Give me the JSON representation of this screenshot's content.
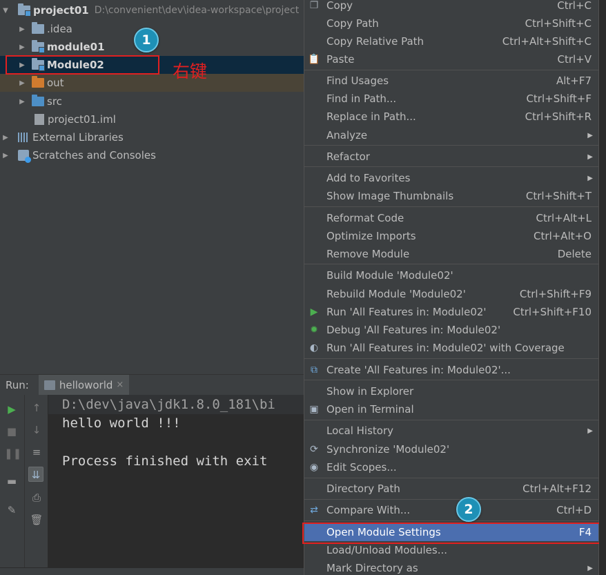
{
  "tree": {
    "project_name": "project01",
    "project_path": "D:\\convenient\\dev\\idea-workspace\\project",
    "items": [
      {
        "label": ".idea"
      },
      {
        "label": "module01"
      },
      {
        "label": "Module02"
      },
      {
        "label": "out"
      },
      {
        "label": "src"
      },
      {
        "label": "project01.iml"
      }
    ],
    "external_libraries": "External Libraries",
    "scratches": "Scratches and Consoles"
  },
  "annotations": {
    "badge1": "1",
    "badge2": "2",
    "right_click_note": "右键",
    "highlight_color": "#e02020"
  },
  "run": {
    "label": "Run:",
    "tab": "helloworld",
    "tab_close": "×",
    "console_lines": [
      "D:\\dev\\java\\jdk1.8.0_181\\bi",
      "hello world !!!",
      "",
      "Process finished with exit"
    ]
  },
  "menu": {
    "items": [
      {
        "label": "Copy",
        "shortcut": "Ctrl+C",
        "icon": "copy-icon"
      },
      {
        "label": "Copy Path",
        "shortcut": "Ctrl+Shift+C"
      },
      {
        "label": "Copy Relative Path",
        "shortcut": "Ctrl+Alt+Shift+C"
      },
      {
        "label": "Paste",
        "shortcut": "Ctrl+V",
        "icon": "paste-icon"
      },
      {
        "label": "Find Usages",
        "shortcut": "Alt+F7"
      },
      {
        "label": "Find in Path...",
        "shortcut": "Ctrl+Shift+F"
      },
      {
        "label": "Replace in Path...",
        "shortcut": "Ctrl+Shift+R"
      },
      {
        "label": "Analyze",
        "shortcut": ""
      },
      {
        "label": "Refactor",
        "shortcut": ""
      },
      {
        "label": "Add to Favorites",
        "shortcut": ""
      },
      {
        "label": "Show Image Thumbnails",
        "shortcut": "Ctrl+Shift+T"
      },
      {
        "label": "Reformat Code",
        "shortcut": "Ctrl+Alt+L"
      },
      {
        "label": "Optimize Imports",
        "shortcut": "Ctrl+Alt+O"
      },
      {
        "label": "Remove Module",
        "shortcut": "Delete"
      },
      {
        "label": "Build Module 'Module02'",
        "shortcut": ""
      },
      {
        "label": "Rebuild Module 'Module02'",
        "shortcut": "Ctrl+Shift+F9"
      },
      {
        "label": "Run 'All Features in: Module02'",
        "shortcut": "Ctrl+Shift+F10",
        "icon": "run-icon"
      },
      {
        "label": "Debug 'All Features in: Module02'",
        "shortcut": "",
        "icon": "debug-icon"
      },
      {
        "label": "Run 'All Features in: Module02' with Coverage",
        "shortcut": "",
        "icon": "coverage-icon"
      },
      {
        "label": "Create 'All Features in: Module02'...",
        "shortcut": "",
        "icon": "create-config-icon"
      },
      {
        "label": "Show in Explorer",
        "shortcut": ""
      },
      {
        "label": "Open in Terminal",
        "shortcut": "",
        "icon": "terminal-icon"
      },
      {
        "label": "Local History",
        "shortcut": ""
      },
      {
        "label": "Synchronize 'Module02'",
        "shortcut": "",
        "icon": "sync-icon"
      },
      {
        "label": "Edit Scopes...",
        "shortcut": "",
        "icon": "scopes-icon"
      },
      {
        "label": "Directory Path",
        "shortcut": "Ctrl+Alt+F12"
      },
      {
        "label": "Compare With...",
        "shortcut": "Ctrl+D",
        "icon": "compare-icon"
      },
      {
        "label": "Open Module Settings",
        "shortcut": "F4"
      },
      {
        "label": "Load/Unload Modules...",
        "shortcut": ""
      },
      {
        "label": "Mark Directory as",
        "shortcut": ""
      }
    ],
    "submenu_arrow": "▶",
    "selected_color": "#4b6eaf"
  }
}
